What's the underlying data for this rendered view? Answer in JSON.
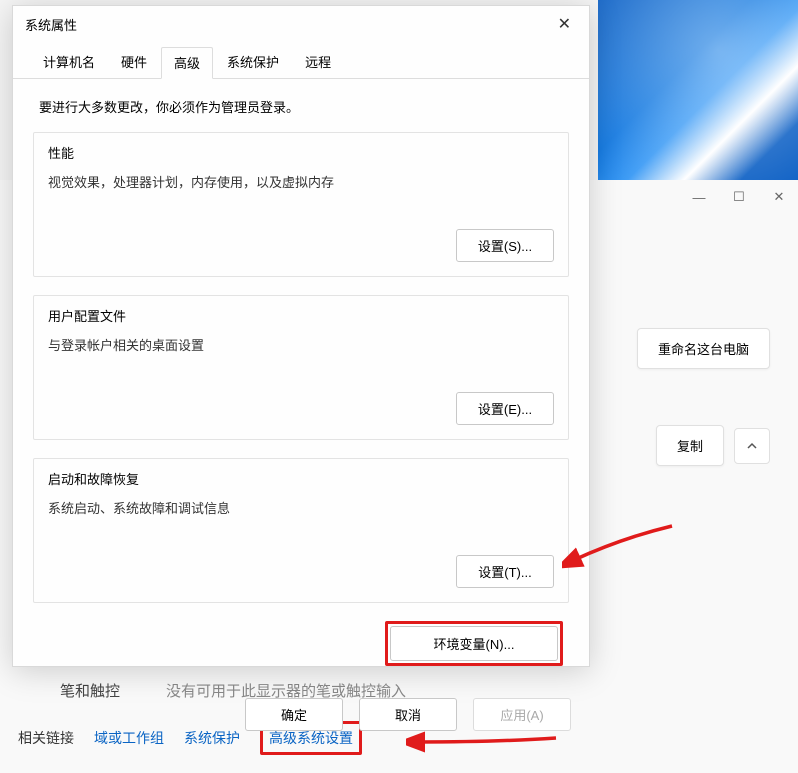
{
  "dialog": {
    "title": "系统属性",
    "close_glyph": "✕",
    "tabs": {
      "computer_name": "计算机名",
      "hardware": "硬件",
      "advanced": "高级",
      "system_protection": "系统保护",
      "remote": "远程"
    },
    "intro": "要进行大多数更改，你必须作为管理员登录。",
    "groups": {
      "performance": {
        "title": "性能",
        "desc": "视觉效果，处理器计划，内存使用，以及虚拟内存",
        "button": "设置(S)..."
      },
      "user_profile": {
        "title": "用户配置文件",
        "desc": "与登录帐户相关的桌面设置",
        "button": "设置(E)..."
      },
      "startup": {
        "title": "启动和故障恢复",
        "desc": "系统启动、系统故障和调试信息",
        "button": "设置(T)..."
      }
    },
    "env_button": "环境变量(N)...",
    "footer": {
      "ok": "确定",
      "cancel": "取消",
      "apply": "应用(A)"
    }
  },
  "background": {
    "rename_button": "重命名这台电脑",
    "copy_button": "复制",
    "pen_touch": {
      "label": "笔和触控",
      "value": "没有可用于此显示器的笔或触控输入"
    },
    "related_links": {
      "label": "相关链接",
      "domain": "域或工作组",
      "protection": "系统保护",
      "advanced_settings": "高级系统设置"
    }
  }
}
